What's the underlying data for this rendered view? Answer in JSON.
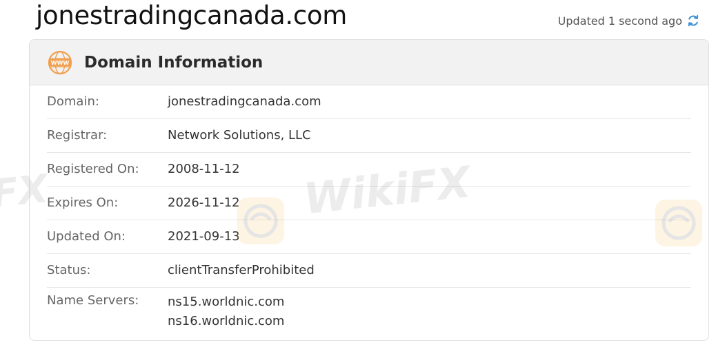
{
  "header": {
    "domain_title": "jonestradingcanada.com",
    "updated_text": "Updated 1 second ago",
    "refresh_icon": "refresh-icon"
  },
  "card": {
    "title": "Domain Information",
    "icon": "www-icon"
  },
  "fields": [
    {
      "label": "Domain:",
      "value": "jonestradingcanada.com"
    },
    {
      "label": "Registrar:",
      "value": "Network Solutions, LLC"
    },
    {
      "label": "Registered On:",
      "value": "2008-11-12"
    },
    {
      "label": "Expires On:",
      "value": "2026-11-12"
    },
    {
      "label": "Updated On:",
      "value": "2021-09-13"
    },
    {
      "label": "Status:",
      "value": "clientTransferProhibited"
    },
    {
      "label": "Name Servers:",
      "values": [
        "ns15.worldnic.com",
        "ns16.worldnic.com"
      ]
    }
  ],
  "watermark": {
    "text": "WikiFX",
    "edge_text": "FX"
  },
  "colors": {
    "accent_orange": "#f0a050",
    "refresh_blue": "#3a8fd8",
    "header_bg": "#f2f2f2"
  }
}
